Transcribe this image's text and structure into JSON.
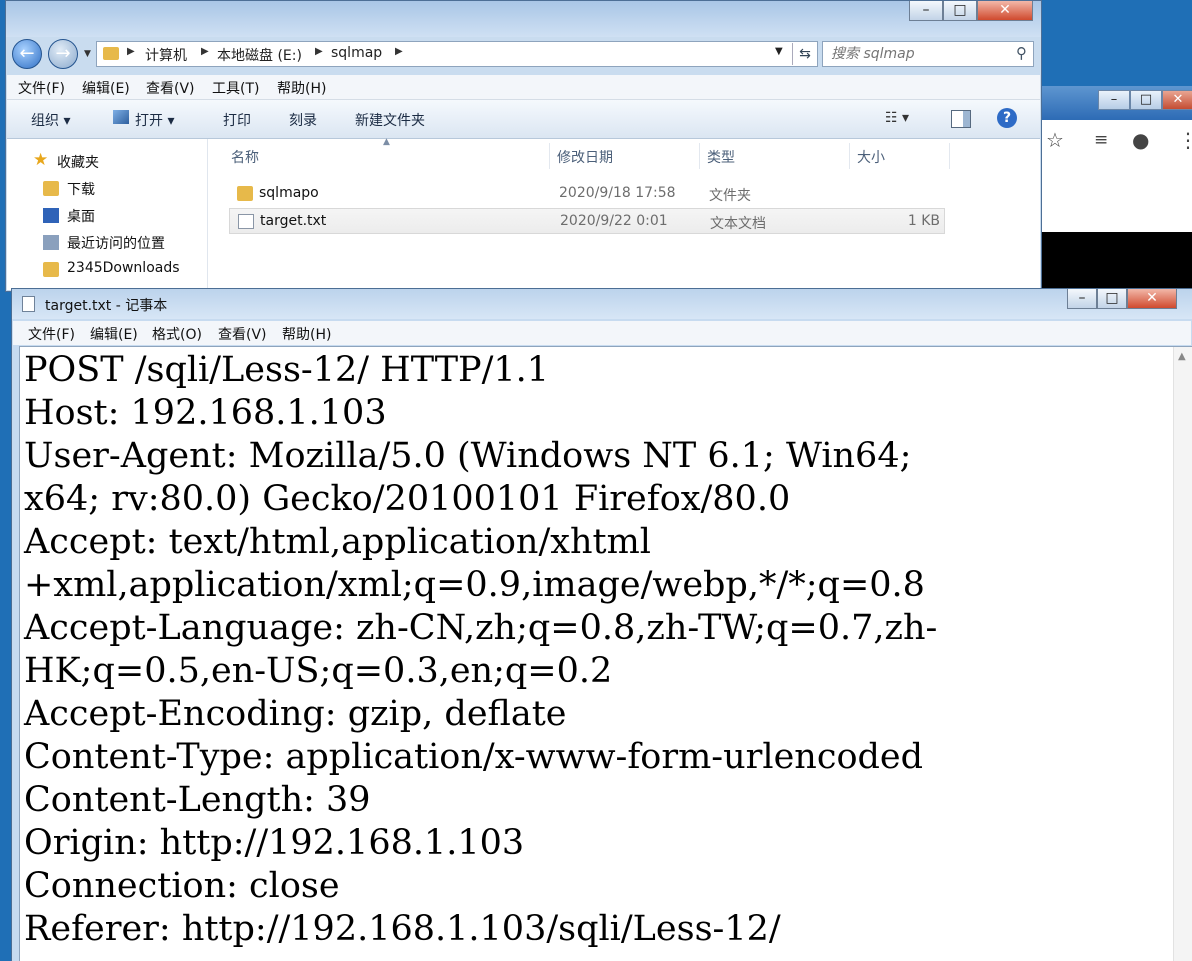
{
  "explorer": {
    "caption_buttons": {
      "minimize": "–",
      "maximize": "□",
      "close": "✕"
    },
    "nav": {
      "back_icon": "arrow-left-icon",
      "forward_icon": "arrow-right-icon"
    },
    "breadcrumb": [
      "计算机",
      "本地磁盘 (E:)",
      "sqlmap"
    ],
    "search_placeholder": "搜索 sqlmap",
    "menu": [
      "文件(F)",
      "编辑(E)",
      "查看(V)",
      "工具(T)",
      "帮助(H)"
    ],
    "toolbar": {
      "organize": "组织 ▾",
      "open": "打开 ▾",
      "print": "打印",
      "burn": "刻录",
      "new_folder": "新建文件夹"
    },
    "sidebar": [
      "收藏夹",
      "下载",
      "桌面",
      "最近访问的位置",
      "2345Downloads"
    ],
    "columns": {
      "name": "名称",
      "date": "修改日期",
      "type": "类型",
      "size": "大小"
    },
    "files": [
      {
        "name": "sqlmapo",
        "date": "2020/9/18 17:58",
        "type": "文件夹",
        "size": ""
      },
      {
        "name": "target.txt",
        "date": "2020/9/22 0:01",
        "type": "文本文档",
        "size": "1 KB"
      }
    ]
  },
  "browser": {
    "caption_buttons": {
      "minimize": "–",
      "maximize": "□",
      "close": "✕"
    },
    "toolbar_icons": [
      "star-icon",
      "reading-list-icon",
      "account-icon",
      "more-icon"
    ]
  },
  "notepad": {
    "title": "target.txt - 记事本",
    "caption_buttons": {
      "minimize": "–",
      "maximize": "□",
      "close": "✕"
    },
    "menu": [
      "文件(F)",
      "编辑(E)",
      "格式(O)",
      "查看(V)",
      "帮助(H)"
    ],
    "content": "POST /sqli/Less-12/ HTTP/1.1\nHost: 192.168.1.103\nUser-Agent: Mozilla/5.0 (Windows NT 6.1; Win64;\nx64; rv:80.0) Gecko/20100101 Firefox/80.0\nAccept: text/html,application/xhtml\n+xml,application/xml;q=0.9,image/webp,*/*;q=0.8\nAccept-Language: zh-CN,zh;q=0.8,zh-TW;q=0.7,zh-\nHK;q=0.5,en-US;q=0.3,en;q=0.2\nAccept-Encoding: gzip, deflate\nContent-Type: application/x-www-form-urlencoded\nContent-Length: 39\nOrigin: http://192.168.1.103\nConnection: close\nReferer: http://192.168.1.103/sqli/Less-12/"
  }
}
